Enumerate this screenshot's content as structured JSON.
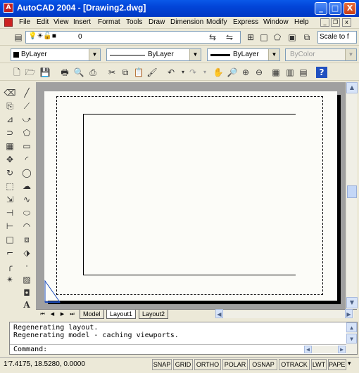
{
  "window": {
    "title": "AutoCAD 2004 - [Drawing2.dwg]",
    "app_icon_letter": "A",
    "minimize": "_",
    "maximize": "□",
    "close": "X",
    "accent_color": "#0245d8"
  },
  "menu": {
    "items": [
      "File",
      "Edit",
      "View",
      "Insert",
      "Format",
      "Tools",
      "Draw",
      "Dimension",
      "Modify",
      "Express",
      "Window",
      "Help"
    ]
  },
  "toolbar_layers": {
    "layer_value": "0",
    "scale_value": "Scale to f"
  },
  "properties": {
    "color": "ByLayer",
    "linetype": "ByLayer",
    "lineweight": "ByLayer",
    "plotstyle": "ByColor"
  },
  "layout_tabs": {
    "tabs": [
      "Model",
      "Layout1",
      "Layout2"
    ],
    "active_index": 1
  },
  "command": {
    "history": [
      "Regenerating layout.",
      "Regenerating model - caching viewports."
    ],
    "prompt": "Command:"
  },
  "status": {
    "coordinates": "1'7.4175, 18.5280, 0.0000",
    "toggles": [
      "SNAP",
      "GRID",
      "ORTHO",
      "POLAR",
      "OSNAP",
      "OTRACK",
      "LWT",
      "PAPER"
    ]
  },
  "icons": {
    "left_col1": [
      "eraser-icon",
      "copy-icon",
      "mirror-icon",
      "offset-icon",
      "array-icon",
      "move-icon",
      "rotate-icon",
      "scale-icon",
      "stretch-icon",
      "trim-icon",
      "extend-icon",
      "break-icon",
      "chamfer-icon",
      "fillet-icon",
      "explode-icon"
    ],
    "left_col2": [
      "line-icon",
      "construction-line-icon",
      "polyline-icon",
      "polygon-icon",
      "rectangle-icon",
      "arc-icon",
      "circle-icon",
      "revision-cloud-icon",
      "spline-icon",
      "ellipse-icon",
      "ellipse-arc-icon",
      "insert-block-icon",
      "make-block-icon",
      "point-icon",
      "hatch-icon",
      "region-icon",
      "mtext-icon"
    ]
  }
}
